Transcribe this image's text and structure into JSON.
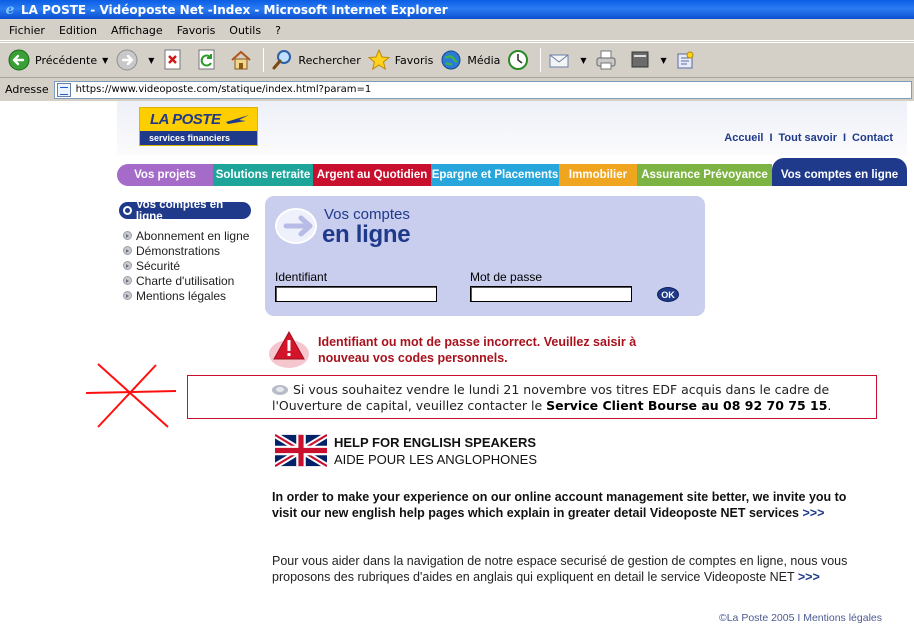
{
  "window": {
    "title": "LA POSTE - Vidéoposte Net -Index - Microsoft Internet Explorer"
  },
  "menu": [
    "Fichier",
    "Edition",
    "Affichage",
    "Favoris",
    "Outils",
    "?"
  ],
  "toolbar": {
    "back_label": "Précédente",
    "search_label": "Rechercher",
    "favorites_label": "Favoris",
    "media_label": "Média"
  },
  "address": {
    "label": "Adresse",
    "url": "https://www.videoposte.com/statique/index.html?param=1"
  },
  "header": {
    "logo_top": "LA POSTE",
    "logo_band": "services financiers",
    "links": [
      "Accueil",
      "Tout savoir",
      "Contact"
    ],
    "link_separator": "I"
  },
  "nav": {
    "tabs": [
      {
        "label": "Vos projets",
        "color": "#a46bc9"
      },
      {
        "label": "Solutions retraite",
        "color": "#1ea59a"
      },
      {
        "label": "Argent au Quotidien",
        "color": "#c8102e"
      },
      {
        "label": "Epargne et Placements",
        "color": "#27a6dc"
      },
      {
        "label": "Immobilier",
        "color": "#f0a521"
      },
      {
        "label": "Assurance Prévoyance",
        "color": "#7cb342"
      },
      {
        "label": "Vos comptes en ligne",
        "color": "#1f3a8a"
      }
    ]
  },
  "sidebar": {
    "title": "Vos comptes en ligne",
    "items": [
      {
        "label": "Abonnement en ligne"
      },
      {
        "label": "Démonstrations"
      },
      {
        "label": "Sécurité"
      },
      {
        "label": "Charte d'utilisation"
      },
      {
        "label": "Mentions légales"
      }
    ]
  },
  "login": {
    "title_line1": "Vos comptes",
    "title_line2": "en ligne",
    "id_label": "Identifiant",
    "id_value": "",
    "password_label": "Mot de passe",
    "password_value": "",
    "ok_label": "OK"
  },
  "error": {
    "message": "Identifiant ou mot de passe incorrect. Veuillez saisir à nouveau vos codes personnels."
  },
  "notice": {
    "text_before": "Si vous souhaitez vendre le lundi 21 novembre vos titres EDF acquis dans le cadre de l'Ouverture de capital, veuillez contacter le ",
    "text_strong": "Service Client Bourse au 08 92 70 75 15",
    "text_after": "."
  },
  "english_help": {
    "title": "HELP FOR ENGLISH SPEAKERS",
    "subtitle": "AIDE POUR LES ANGLOPHONES",
    "en_paragraph": "In order to make your experience on our online account management site better, we invite you to visit our new english help pages which explain in greater detail Videoposte NET services ",
    "en_link": ">>>",
    "fr_paragraph": "Pour vous aider dans la navigation de notre espace securisé de gestion de comptes en ligne, nous vous proposons des rubriques d'aides en anglais qui expliquent en detail le service Videoposte NET ",
    "fr_link": ">>>"
  },
  "footer": {
    "text": "©La Poste 2005 I Mentions légales"
  },
  "colors": {
    "brand_blue": "#1f3a8a",
    "brand_yellow": "#ffce00",
    "error_red": "#a8121c",
    "login_bg": "#c9cdee"
  }
}
